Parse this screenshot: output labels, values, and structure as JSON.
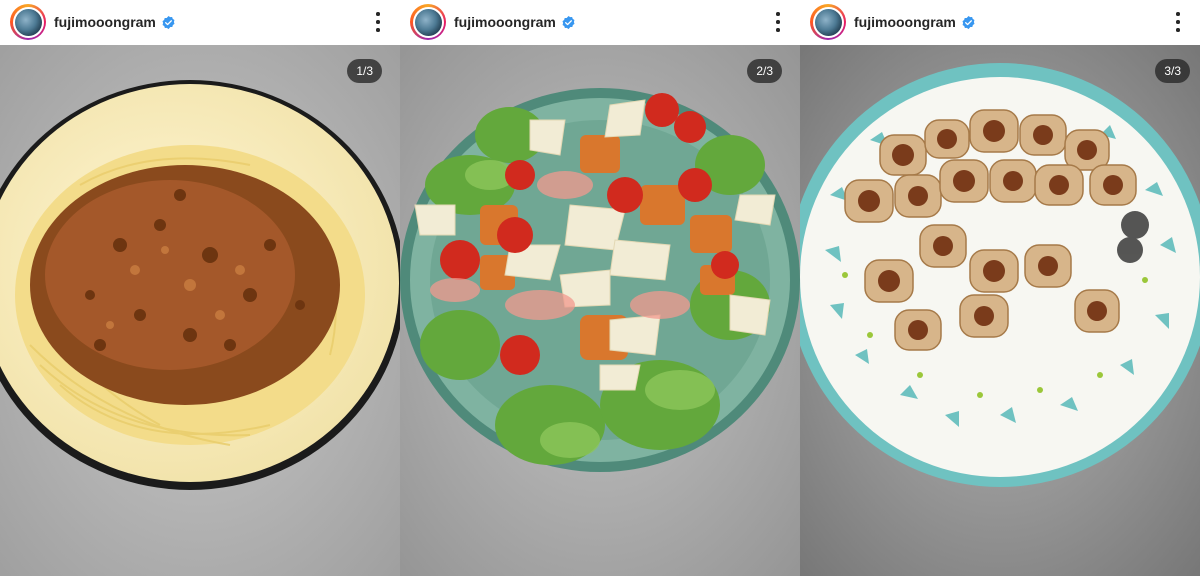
{
  "posts": [
    {
      "username": "fujimooongram",
      "counter": "1/3",
      "image_icon": "spaghetti-bolognese-photo"
    },
    {
      "username": "fujimooongram",
      "counter": "2/3",
      "image_icon": "salad-plate-photo"
    },
    {
      "username": "fujimooongram",
      "counter": "3/3",
      "image_icon": "sausage-rolls-photo"
    }
  ],
  "colors": {
    "verified_badge": "#3897f0",
    "counter_bg": "#262626"
  }
}
